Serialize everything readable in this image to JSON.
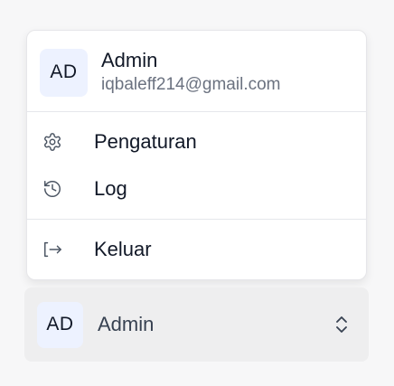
{
  "user_menu": {
    "avatar_initials": "AD",
    "user_name": "Admin",
    "user_email": "iqbaleff214@gmail.com",
    "items": [
      {
        "label": "Pengaturan",
        "icon": "gear-icon"
      },
      {
        "label": "Log",
        "icon": "history-icon"
      }
    ],
    "logout": {
      "label": "Keluar",
      "icon": "logout-icon"
    }
  },
  "account_switcher": {
    "avatar_initials": "AD",
    "name": "Admin",
    "icon": "chevrons-up-down-icon"
  },
  "colors": {
    "avatar_bg": "#edf2ff",
    "menu_bg": "#ffffff",
    "switcher_bg": "#eeeeef",
    "muted_text": "#6b7280"
  }
}
